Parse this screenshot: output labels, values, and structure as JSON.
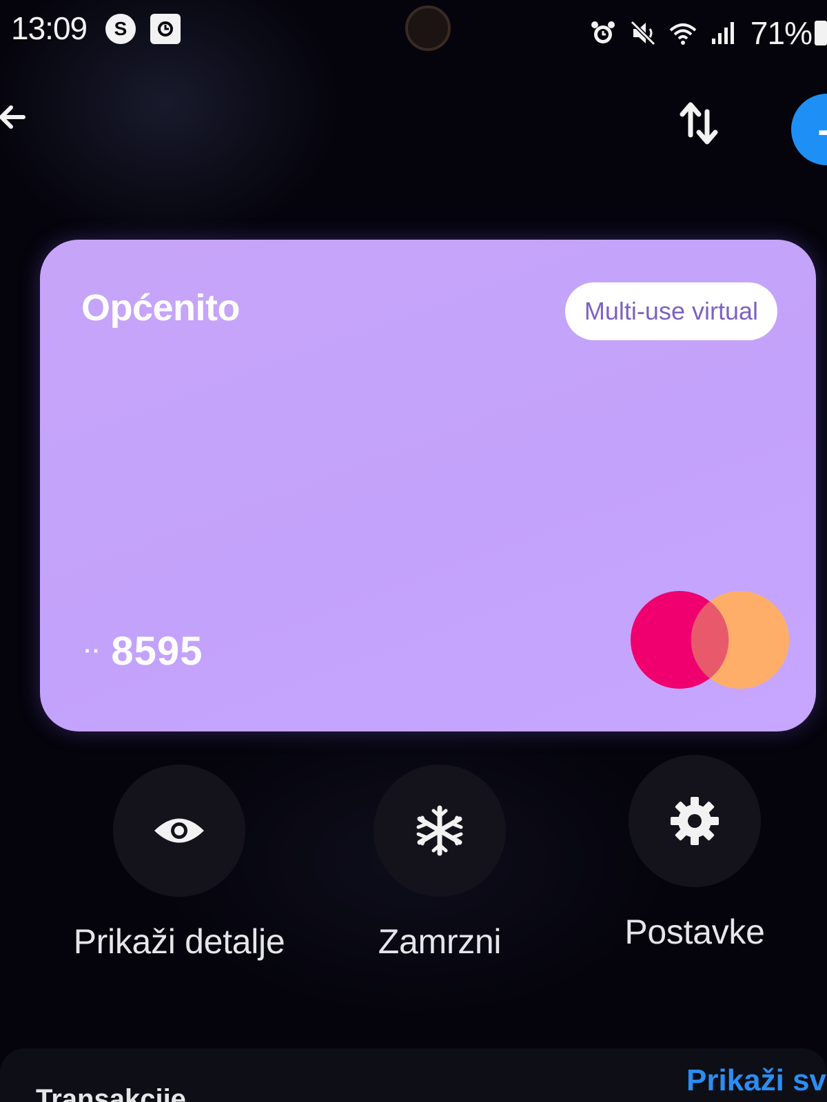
{
  "status_bar": {
    "time": "13:09",
    "notification_icons": [
      "s-app-icon",
      "screenshot-icon"
    ],
    "battery_percent": "71%",
    "system_icons": [
      "alarm-icon",
      "mute-icon",
      "wifi-icon",
      "signal-icon",
      "battery-icon"
    ]
  },
  "top_bar": {
    "back_icon": "back-arrow-icon",
    "sort_icon": "sort-arrows-icon",
    "add_icon": "plus-icon"
  },
  "card": {
    "name": "Općenito",
    "type_badge": "Multi-use virtual",
    "masked_prefix": "··",
    "last4": "8595",
    "network_logo": "mastercard-logo",
    "colors": {
      "card_background": "#c4a4fa",
      "logo_red": "#f0006e",
      "logo_orange": "#ffae6a"
    }
  },
  "actions": [
    {
      "label": "Prikaži detalje",
      "icon": "eye-icon"
    },
    {
      "label": "Zamrzni",
      "icon": "snowflake-icon"
    },
    {
      "label": "Postavke",
      "icon": "gear-icon"
    }
  ],
  "transactions": {
    "title": "Transakcije",
    "view_all_label": "Prikaži sve"
  },
  "colors": {
    "background": "#05040c",
    "accent_blue": "#1e90f5"
  }
}
